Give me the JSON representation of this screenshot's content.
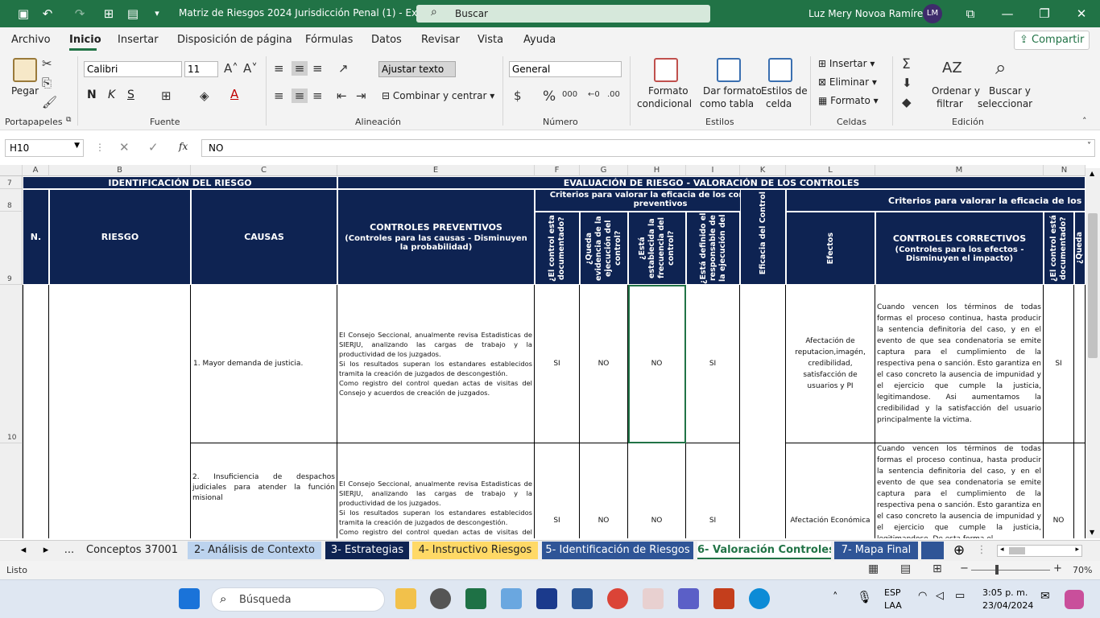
{
  "window": {
    "title": "Matriz de Riesgos 2024 Jurisdicción Penal (1)  -  Excel",
    "search_placeholder": "Buscar",
    "user": "Luz Mery Novoa Ramírez",
    "initials": "LM"
  },
  "menu": [
    "Archivo",
    "Inicio",
    "Insertar",
    "Disposición de página",
    "Fórmulas",
    "Datos",
    "Revisar",
    "Vista",
    "Ayuda"
  ],
  "share": "Compartir",
  "ribbon": {
    "paste": "Pegar",
    "font": "Calibri",
    "font_size": "11",
    "wrap": "Ajustar texto",
    "merge": "Combinar y centrar",
    "number_format": "General",
    "cond_format_1": "Formato",
    "cond_format_2": "condicional",
    "table_1": "Dar formato",
    "table_2": "como tabla",
    "styles_1": "Estilos de",
    "styles_2": "celda",
    "insert": "Insertar",
    "delete": "Eliminar",
    "format": "Formato",
    "sort_1": "Ordenar y",
    "sort_2": "filtrar",
    "find_1": "Buscar y",
    "find_2": "seleccionar",
    "bold": "N",
    "italic": "K",
    "underline": "S",
    "groups": [
      "Portapapeles",
      "Fuente",
      "Alineación",
      "Número",
      "Estilos",
      "Celdas",
      "Edición"
    ]
  },
  "formula": {
    "cell": "H10",
    "value": "NO",
    "fx": "fx"
  },
  "columns": [
    "A",
    "B",
    "C",
    "E",
    "F",
    "G",
    "H",
    "I",
    "K",
    "L",
    "M",
    "N"
  ],
  "rows": [
    "7",
    "8",
    "9",
    "10"
  ],
  "headers": {
    "identificacion": "IDENTIFICACIÓN DEL RIESGO",
    "evaluacion": "EVALUACIÓN DE RIESGO - VALORACIÓN DE LOS CONTROLES",
    "n": "N.",
    "riesgo": "RIESGO",
    "causas": "CAUSAS",
    "prev_title": "CONTROLES PREVENTIVOS",
    "prev_sub": "(Controles para las causas - Disminuyen la probabilidad)",
    "crit_prev": "Criterios para valorar la eficacia de los controles preventivos",
    "crit_corr": "Criterios para  valorar la eficacia de los cont",
    "f": "¿El control esta documentado?",
    "g": "¿Queda evidencia de la ejecución del control?",
    "h": "¿Está establecida la frecuencia del control?",
    "i": "¿Está definido el responsable de la ejecución del",
    "k": "Eficacia del Control",
    "l": "Efectos",
    "corr_title": "CONTROLES CORRECTIVOS",
    "corr_sub": "(Controles para los efectos - Disminuyen el impacto)",
    "n_col": "¿El control está documentado?",
    "o_col": "¿Queda"
  },
  "data_rows": [
    {
      "cause": "1. Mayor demanda de justicia.",
      "control": "El Consejo Seccional, anualmente revisa Estadisticas de SIERJU, analizando las cargas de trabajo y la productividad de los juzgados.\nSi los resultados superan los estandares establecidos tramita la creación de juzgados de descongestión.\nComo registro del control quedan actas de visitas del Consejo y acuerdos de creación de juzgados.",
      "f": "SI",
      "g": "NO",
      "h": "NO",
      "i": "SI",
      "effect": "Afectación de reputacion,imagén, credibilidad, satisfacción de usuarios y PI",
      "corrective": "Cuando vencen los términos de todas formas el proceso continua, hasta producir la sentencia definitoria del caso, y en el evento de que sea condenatoria se emite captura para el cumplimiento de la respectiva pena o sanción. Esto garantiza en el caso concreto la ausencia de impunidad y el ejercicio que cumple la justicia, legitimandose. Asi aumentamos la credibilidad y la satisfacción del usuario principalmente la victima.",
      "n": "SI"
    },
    {
      "cause": "2. Insuficiencia de despachos judiciales para atender la función misional",
      "control": "El Consejo Seccional, anualmente revisa Estadisticas de SIERJU, analizando las cargas de trabajo y la productividad de los juzgados.\nSi los resultados superan los estandares establecidos tramita la creación de juzgados de descongestión.\nComo registro del control quedan actas de visitas del Consejo y acuerdos de creación de juzgados.",
      "f": "SI",
      "g": "NO",
      "h": "NO",
      "i": "SI",
      "effect": "Afectación Económica",
      "corrective": "Cuando vencen los términos de todas formas el proceso continua, hasta producir la sentencia definitoria del caso, y en el evento de que sea condenatoria se emite captura para el cumplimiento de la respectiva pena o sanción. Esto garantiza en el caso concreto la ausencia de impunidad y el ejercicio que cumple la justicia, legitimandose. De esta forma el",
      "n": "NO"
    }
  ],
  "tabs": [
    {
      "label": "...",
      "color": "#f0f0f0",
      "fg": "#222"
    },
    {
      "label": "Conceptos 37001",
      "color": "#f0f0f0",
      "fg": "#222"
    },
    {
      "label": "2- Análisis de Contexto",
      "color": "#bcd3ee",
      "fg": "#222"
    },
    {
      "label": "3- Estrategias",
      "color": "#0e2352",
      "fg": "#fff"
    },
    {
      "label": "4- Instructivo Riesgos",
      "color": "#ffd966",
      "fg": "#222"
    },
    {
      "label": "5- Identificación de Riesgos",
      "color": "#2f5597",
      "fg": "#fff"
    },
    {
      "label": "6- Valoración Controles",
      "color": "#ffffff",
      "fg": "#217346"
    },
    {
      "label": "7- Mapa Final",
      "color": "#2f5597",
      "fg": "#fff"
    }
  ],
  "status": {
    "mode": "Listo",
    "zoom": "70%"
  },
  "taskbar": {
    "search": "Búsqueda",
    "lang_1": "ESP",
    "lang_2": "LAA",
    "time": "3:05 p. m.",
    "date": "23/04/2024"
  }
}
